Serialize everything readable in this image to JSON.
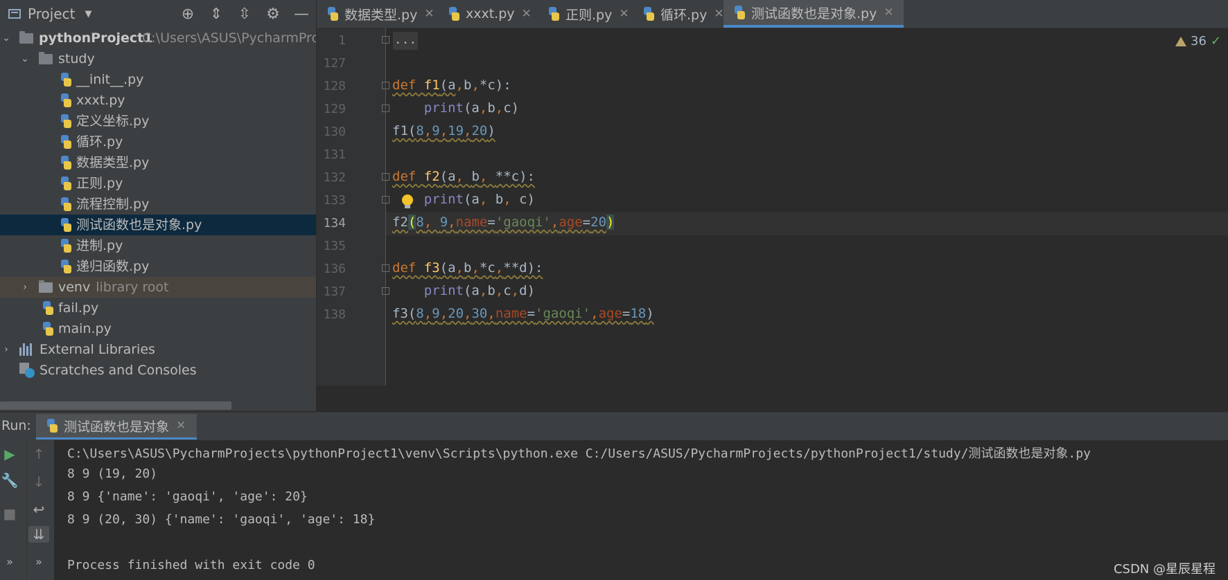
{
  "project_panel": {
    "title": "Project",
    "tree": {
      "root": {
        "name": "pythonProject1",
        "path": "C:\\Users\\ASUS\\PycharmProjec"
      },
      "study_folder": "study",
      "study_files": [
        "__init__.py",
        "xxxt.py",
        "定义坐标.py",
        "循环.py",
        "数据类型.py",
        "正则.py",
        "流程控制.py",
        "测试函数也是对象.py",
        "进制.py",
        "递归函数.py"
      ],
      "selected_file": "测试函数也是对象.py",
      "venv": {
        "name": "venv",
        "hint": "library root"
      },
      "root_files": [
        "fail.py",
        "main.py"
      ],
      "external_libraries": "External Libraries",
      "scratches": "Scratches and Consoles"
    }
  },
  "editor": {
    "tabs": [
      {
        "label": "数据类型.py",
        "active": false
      },
      {
        "label": "xxxt.py",
        "active": false
      },
      {
        "label": "正则.py",
        "active": false
      },
      {
        "label": "循环.py",
        "active": false
      },
      {
        "label": "测试函数也是对象.py",
        "active": true
      }
    ],
    "collapsed_placeholder": "...",
    "inspection_count": "36",
    "current_line": "134",
    "lines": [
      {
        "num": "1",
        "text": ""
      },
      {
        "num": "127",
        "text": ""
      },
      {
        "num": "128",
        "text": "def f1(a,b,*c):"
      },
      {
        "num": "129",
        "text": "    print(a,b,c)"
      },
      {
        "num": "130",
        "text": "f1(8,9,19,20)"
      },
      {
        "num": "131",
        "text": ""
      },
      {
        "num": "132",
        "text": "def f2(a, b, **c):"
      },
      {
        "num": "133",
        "text": "    print(a, b, c)"
      },
      {
        "num": "134",
        "text": "f2(8, 9,name='gaoqi',age=20)"
      },
      {
        "num": "135",
        "text": ""
      },
      {
        "num": "136",
        "text": "def f3(a,b,*c,**d):"
      },
      {
        "num": "137",
        "text": "    print(a,b,c,d)"
      },
      {
        "num": "138",
        "text": "f3(8,9,20,30,name='gaoqi',age=18)"
      }
    ]
  },
  "run_panel": {
    "label": "Run:",
    "tab_label": "测试函数也是对象",
    "output": [
      "C:\\Users\\ASUS\\PycharmProjects\\pythonProject1\\venv\\Scripts\\python.exe C:/Users/ASUS/PycharmProjects/pythonProject1/study/测试函数也是对象.py",
      "8 9 (19, 20)",
      "8 9 {'name': 'gaoqi', 'age': 20}",
      "8 9 (20, 30) {'name': 'gaoqi', 'age': 18}",
      "",
      "Process finished with exit code 0"
    ]
  },
  "watermark": "CSDN @星辰星程",
  "colors": {
    "background": "#2b2b2b",
    "panel": "#3c3f41",
    "selection": "#0d293e",
    "keyword": "#cc7832",
    "function": "#ffc66d",
    "number": "#6897bb",
    "string": "#6a8759",
    "param": "#aa4926",
    "builtin": "#8888c6",
    "accent": "#4a88c7"
  }
}
